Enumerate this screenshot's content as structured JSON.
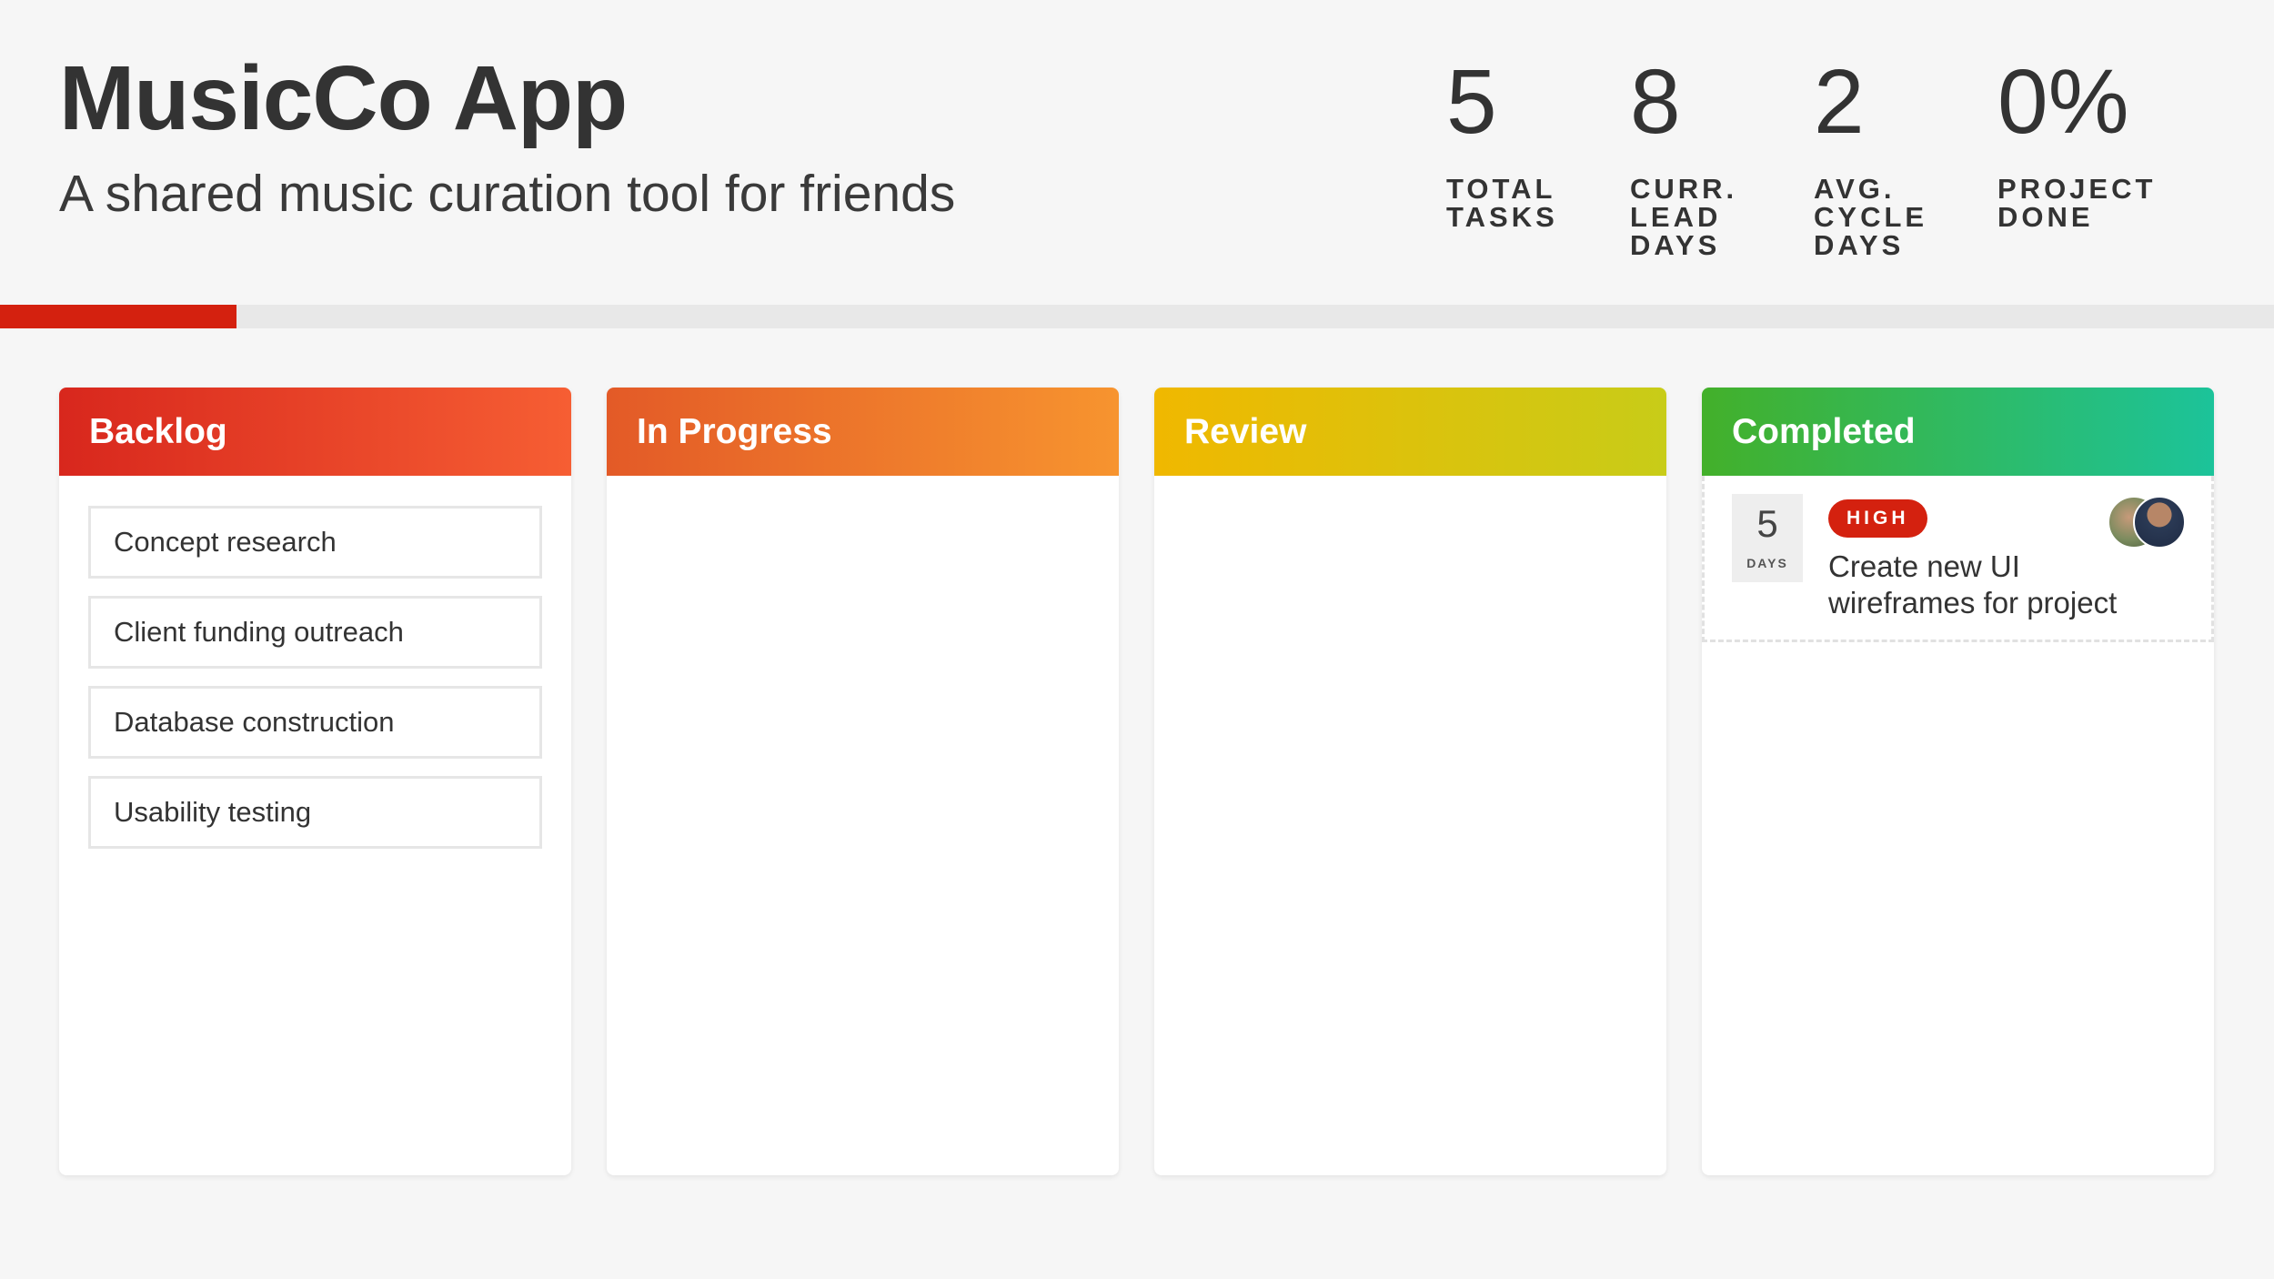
{
  "header": {
    "title": "MusicCo App",
    "subtitle": "A shared music curation tool for friends"
  },
  "stats": [
    {
      "value": "5",
      "label": "TOTAL TASKS"
    },
    {
      "value": "8",
      "label": "CURR. LEAD DAYS"
    },
    {
      "value": "2",
      "label": "AVG. CYCLE DAYS"
    },
    {
      "value": "0%",
      "label": "PROJECT DONE"
    }
  ],
  "progress": {
    "fraction": 0.104,
    "color": "#d4210f"
  },
  "columns": {
    "backlog": {
      "title": "Backlog",
      "tasks": [
        "Concept research",
        "Client funding outreach",
        "Database construction",
        "Usability testing"
      ]
    },
    "in_progress": {
      "title": "In Progress",
      "tasks": []
    },
    "review": {
      "title": "Review",
      "tasks": []
    },
    "completed": {
      "title": "Completed",
      "card": {
        "days": "5",
        "days_label": "DAYS",
        "priority": "HIGH",
        "title": "Create new UI wireframes for project",
        "assignee_icon": "avatar-group-icon"
      }
    }
  },
  "colors": {
    "backlog": "#e0321f",
    "in_progress": "#f07a2b",
    "review": "#e3c10a",
    "completed": "#2dba5e",
    "priority_high": "#d4210f"
  }
}
